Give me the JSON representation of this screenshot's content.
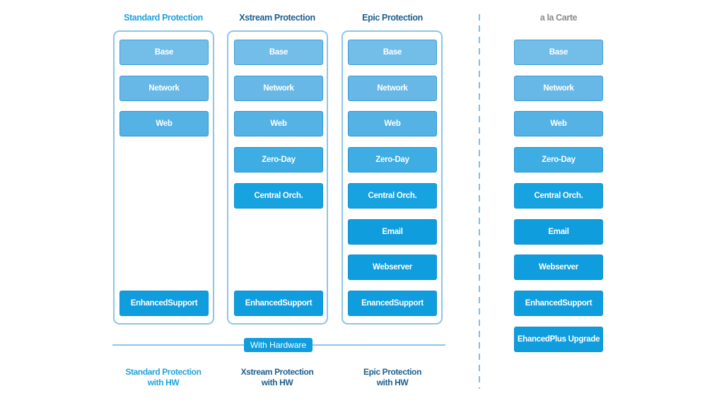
{
  "colors": {
    "standard_title": "#1ea3dd",
    "dark_title": "#1d5f8f",
    "alacarte_title": "#8a8a8a",
    "panel_border": "#8cc6e8",
    "tile_accent": "#0f9dde"
  },
  "columns": [
    {
      "title": "Standard Protection",
      "tiles": [
        "Base",
        "Network",
        "Web"
      ],
      "support": [
        "Enhanced",
        "Support"
      ],
      "bottom_label": [
        "Standard Protection",
        "with HW"
      ]
    },
    {
      "title": "Xstream Protection",
      "tiles": [
        "Base",
        "Network",
        "Web",
        "Zero-Day",
        "Central Orch."
      ],
      "support": [
        "Enhanced",
        "Support"
      ],
      "bottom_label": [
        "Xstream Protection",
        "with HW"
      ]
    },
    {
      "title": "Epic Protection",
      "tiles": [
        "Base",
        "Network",
        "Web",
        "Zero-Day",
        "Central Orch.",
        "Email",
        "Webserver"
      ],
      "support": [
        "Enanced",
        "Support"
      ],
      "bottom_label": [
        "Epic Protection",
        "with HW"
      ]
    }
  ],
  "alacarte": {
    "title": "a la Carte",
    "tiles": [
      "Base",
      "Network",
      "Web",
      "Zero-Day",
      "Central Orch.",
      "Email",
      "Webserver"
    ],
    "support": [
      "Enhanced",
      "Support"
    ],
    "upgrade": [
      "Ehanced",
      "Plus Upgrade"
    ]
  },
  "hardware_badge": "With Hardware"
}
